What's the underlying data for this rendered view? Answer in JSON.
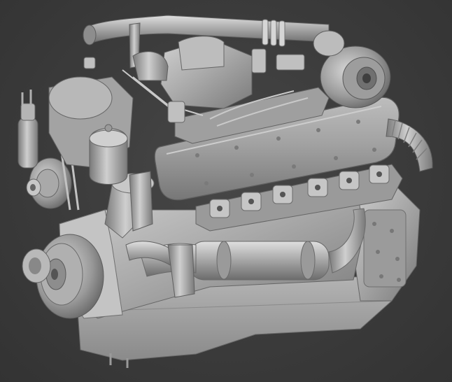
{
  "scene": {
    "subject": "engine-3d-render",
    "background_color": "#3b3b3b",
    "model_color": "#a9a9a9",
    "highlight_color": "#d4d4d4",
    "shadow_color": "#6e6e6e"
  }
}
